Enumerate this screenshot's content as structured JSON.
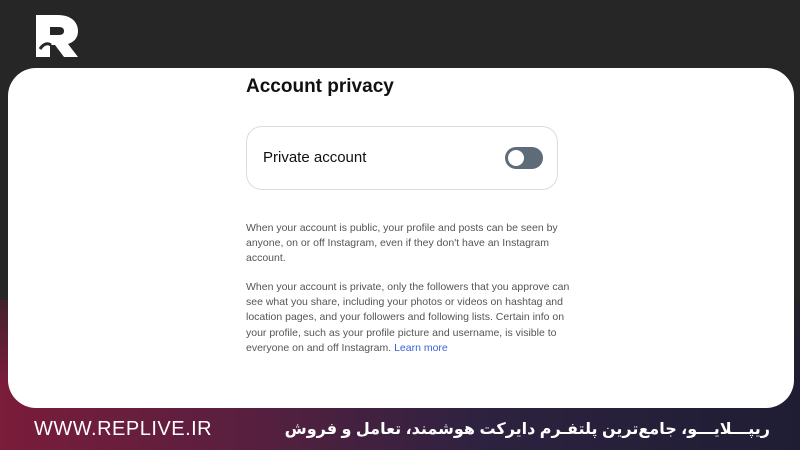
{
  "brand": {
    "logo_icon": "replive-logo-icon"
  },
  "settings": {
    "title": "Account privacy",
    "private_account": {
      "label": "Private account",
      "enabled": false
    },
    "paragraph_public": "When your account is public, your profile and posts can be seen by anyone, on or off Instagram, even if they don't have an Instagram account.",
    "paragraph_private": "When your account is private, only the followers that you approve can see what you share, including your photos or videos on hashtag and location pages, and your followers and following lists. Certain info on your profile, such as your profile picture and username, is visible to everyone on and off Instagram.",
    "learn_more": "Learn more"
  },
  "footer": {
    "url": "WWW.REPLIVE.IR",
    "tagline": "ریپـــلایـــو، جامع‌ترین پلتفـرم دایرکت هوشمند، تعامل و فروش"
  },
  "colors": {
    "toggle_off": "#5e6b78",
    "link": "#3b5fd6",
    "card": "#ffffff"
  }
}
